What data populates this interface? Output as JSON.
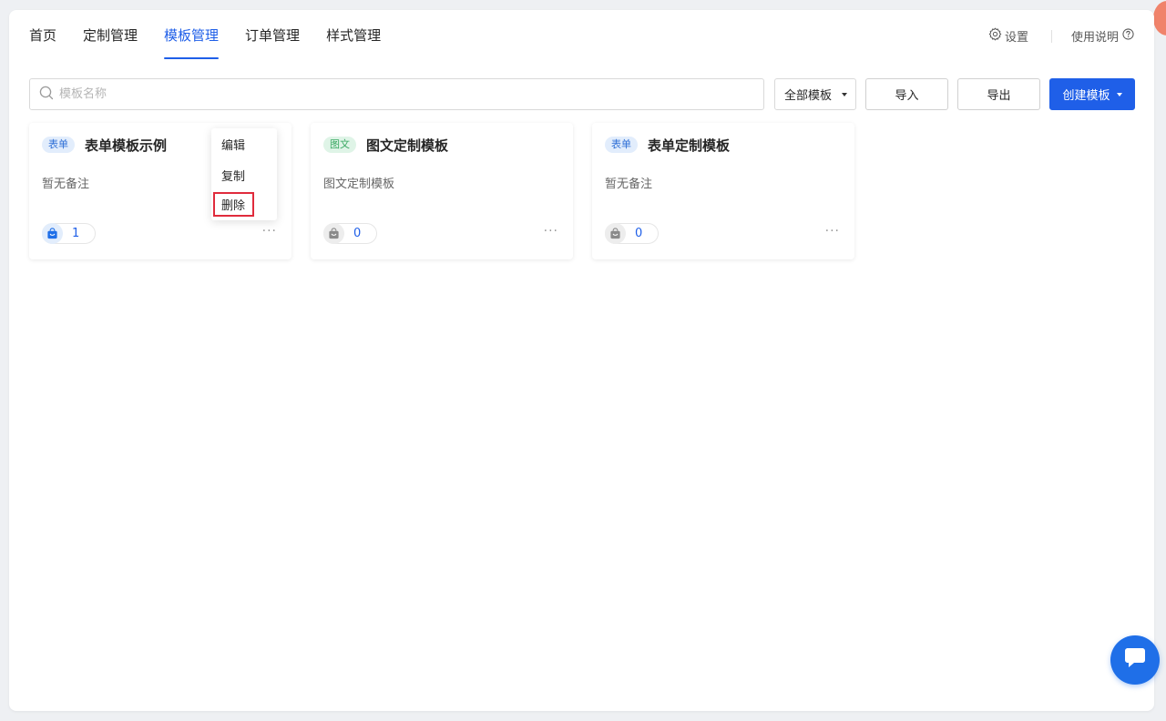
{
  "nav": {
    "items": [
      {
        "label": "首页",
        "active": false
      },
      {
        "label": "定制管理",
        "active": false
      },
      {
        "label": "模板管理",
        "active": true
      },
      {
        "label": "订单管理",
        "active": false
      },
      {
        "label": "样式管理",
        "active": false
      }
    ]
  },
  "header": {
    "settings_label": "设置",
    "help_label": "使用说明"
  },
  "toolbar": {
    "search_placeholder": "模板名称",
    "search_value": "",
    "filter_value": "全部模板",
    "import_label": "导入",
    "export_label": "导出",
    "create_label": "创建模板"
  },
  "cards": [
    {
      "tag": "表单",
      "tag_type": "form",
      "title": "表单模板示例",
      "note": "暂无备注",
      "count": "1"
    },
    {
      "tag": "图文",
      "tag_type": "pic",
      "title": "图文定制模板",
      "note": "图文定制模板",
      "count": "0"
    },
    {
      "tag": "表单",
      "tag_type": "form",
      "title": "表单定制模板",
      "note": "暂无备注",
      "count": "0"
    }
  ],
  "dropdown": {
    "items": [
      "编辑",
      "复制",
      "删除"
    ]
  },
  "colors": {
    "primary": "#1f5fe8",
    "delete_highlight": "#e02b3c",
    "tag_form_bg": "#e2edfc",
    "tag_pic_bg": "#dff4e7"
  }
}
